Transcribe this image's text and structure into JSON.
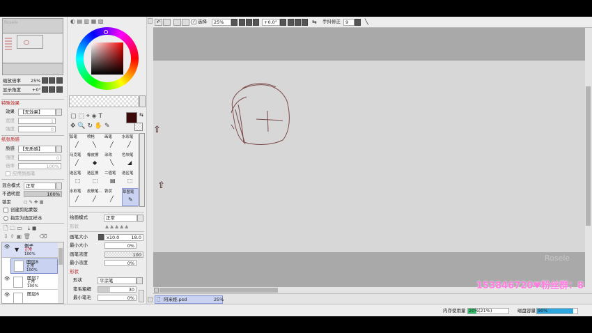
{
  "navigator": {
    "title": "Rosele"
  },
  "zoom": {
    "label": "缩放倍率",
    "value": "25%"
  },
  "rotation": {
    "label": "显示角度",
    "value": "+0°"
  },
  "effects": {
    "header": "特殊效果",
    "effect_label": "效果",
    "effect_value": "【无效果】",
    "strength_label": "宽度",
    "strength_value": "1",
    "intensity_label": "强度",
    "intensity_value": "0"
  },
  "texture": {
    "header": "纸张质感",
    "label": "质感",
    "value": "【无质感】",
    "strength_label": "强度",
    "strength_value": "0",
    "scale_label": "倍率",
    "scale_value": "100%",
    "apply_label": "应用到画笔"
  },
  "layer_props": {
    "blend_label": "混合模式",
    "blend_value": "正常",
    "opacity_label": "不透明度",
    "opacity_value": "100%",
    "lock_label": "锁定",
    "clip_label": "创建剪贴蒙版",
    "sample_label": "指定为选区样本"
  },
  "layers": [
    {
      "name": "例子",
      "mode": "正常",
      "opacity": "100%",
      "type": "folder"
    },
    {
      "name": "图层8",
      "mode": "正常",
      "opacity": "100%",
      "type": "layer"
    },
    {
      "name": "图层7",
      "mode": "正常",
      "opacity": "100%",
      "type": "layer"
    },
    {
      "name": "图层6",
      "mode": "",
      "opacity": "",
      "type": "layer"
    }
  ],
  "tools": [
    {
      "label": "铅笔"
    },
    {
      "label": "喷枪"
    },
    {
      "label": "画笔"
    },
    {
      "label": "水彩笔"
    },
    {
      "label": "马克笔"
    },
    {
      "label": "橡皮擦"
    },
    {
      "label": "涂改"
    },
    {
      "label": "色块笔"
    },
    {
      "label": "选区笔"
    },
    {
      "label": "选区擦"
    },
    {
      "label": "二值笔"
    },
    {
      "label": "选区笔"
    },
    {
      "label": "水彩笔"
    },
    {
      "label": "皮肤笔..."
    },
    {
      "label": "铁状"
    },
    {
      "label": "草图笔"
    }
  ],
  "brush": {
    "draw_mode_label": "绘画模式",
    "draw_mode_value": "正常",
    "shape_label": "形状",
    "size_label": "画笔大小",
    "size_mult": "x10.0",
    "size_value": "18.0",
    "min_size_label": "最小大小",
    "min_size_value": "0%",
    "density_label": "画笔浓度",
    "density_value": "100",
    "min_density_label": "最小浓度",
    "min_density_value": "0%",
    "shape_section": "形状",
    "shape2_label": "形状",
    "shape2_value": "平涂笔",
    "thickness_label": "笔毛粗细",
    "thickness_value": "30",
    "min_hair_label": "最小笔毛",
    "min_hair_value": "0%"
  },
  "toolbar": {
    "select_label": "选择",
    "zoom_value": "25%",
    "angle_value": "+0.0°",
    "stabilizer_label": "手抖修正",
    "stabilizer_value": "9"
  },
  "canvas": {
    "watermark": "Rosele"
  },
  "overlay_text": "153846720♥粉丝群：8",
  "document_tab": {
    "name": "阿米娅.psd",
    "zoom": "25%"
  },
  "status": {
    "memory_label": "内存使用量",
    "memory_value": "20%",
    "memory_extra": "(21%)",
    "memory_fraction": 0.2,
    "disk_label": "磁盘容量",
    "disk_value": "90%",
    "disk_fraction": 0.9
  },
  "colors": {
    "current_color": "#3a0a0a",
    "selection_blue": "#c9d3f1",
    "disk_bar": "#2ea7e0",
    "memory_bar": "#33c06f"
  }
}
